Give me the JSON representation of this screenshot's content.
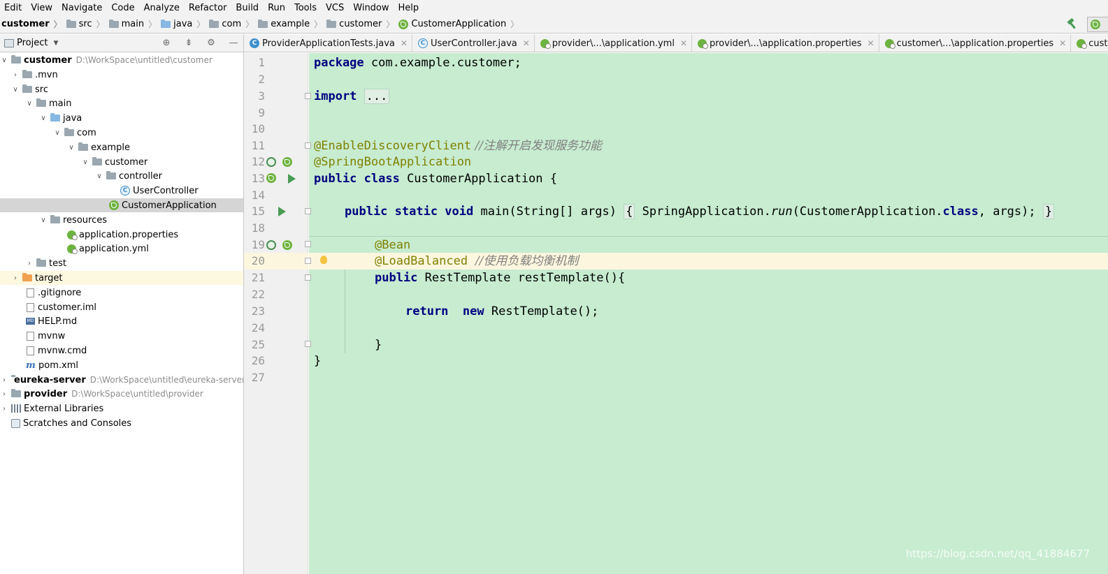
{
  "menu": [
    "Edit",
    "View",
    "Navigate",
    "Code",
    "Analyze",
    "Refactor",
    "Build",
    "Run",
    "Tools",
    "VCS",
    "Window",
    "Help"
  ],
  "breadcrumb": [
    "customer",
    "src",
    "main",
    "java",
    "com",
    "example",
    "customer",
    "CustomerApplication"
  ],
  "project_panel": {
    "title": "Project",
    "tree": [
      {
        "label": "customer",
        "path": "D:\\WorkSpace\\untitled\\customer"
      },
      {
        "label": ".mvn"
      },
      {
        "label": "src"
      },
      {
        "label": "main"
      },
      {
        "label": "java"
      },
      {
        "label": "com"
      },
      {
        "label": "example"
      },
      {
        "label": "customer"
      },
      {
        "label": "controller"
      },
      {
        "label": "UserController"
      },
      {
        "label": "CustomerApplication"
      },
      {
        "label": "resources"
      },
      {
        "label": "application.properties"
      },
      {
        "label": "application.yml"
      },
      {
        "label": "test"
      },
      {
        "label": "target"
      },
      {
        "label": ".gitignore"
      },
      {
        "label": "customer.iml"
      },
      {
        "label": "HELP.md"
      },
      {
        "label": "mvnw"
      },
      {
        "label": "mvnw.cmd"
      },
      {
        "label": "pom.xml"
      },
      {
        "label": "eureka-server",
        "path": "D:\\WorkSpace\\untitled\\eureka-server"
      },
      {
        "label": "provider",
        "path": "D:\\WorkSpace\\untitled\\provider"
      },
      {
        "label": "External Libraries"
      },
      {
        "label": "Scratches and Consoles"
      }
    ]
  },
  "tabs": [
    "ProviderApplicationTests.java",
    "UserController.java",
    "provider\\...\\application.yml",
    "provider\\...\\application.properties",
    "customer\\...\\application.properties",
    "customer\\...\\applicati"
  ],
  "editor": {
    "line_numbers": [
      "1",
      "2",
      "3",
      "9",
      "10",
      "11",
      "12",
      "13",
      "14",
      "15",
      "18",
      "19",
      "20",
      "21",
      "22",
      "23",
      "24",
      "25",
      "26",
      "27"
    ],
    "code": {
      "l1_kw": "package",
      "l1_rest": " com.example.customer;",
      "l3_kw": "import",
      "l3_fold": "...",
      "l11_anno": "@EnableDiscoveryClient",
      "l11_cmt": " //注解开启发现服务功能",
      "l12_anno": "@SpringBootApplication",
      "l13_kw": "public class",
      "l13_rest": " CustomerApplication {",
      "l15_kw1": "public static void",
      "l15_a": " main(String[] args) ",
      "l15_fold1": "{",
      "l15_b": " SpringApplication.",
      "l15_run": "run",
      "l15_c": "(CustomerApplication.",
      "l15_cls": "class",
      "l15_d": ", args); ",
      "l15_fold2": "}",
      "l19_anno": "@Bean",
      "l20_anno": "@LoadBalanced",
      "l20_cmt": "  //使用负载均衡机制",
      "l21_kw": "public",
      "l21_rest": " RestTemplate restTemplate(){",
      "l23_kw1": "return",
      "l23_kw2": "new",
      "l23_rest": " RestTemplate();",
      "l25": "}",
      "l26": "}"
    }
  },
  "watermark": "https://blog.csdn.net/qq_41884677"
}
